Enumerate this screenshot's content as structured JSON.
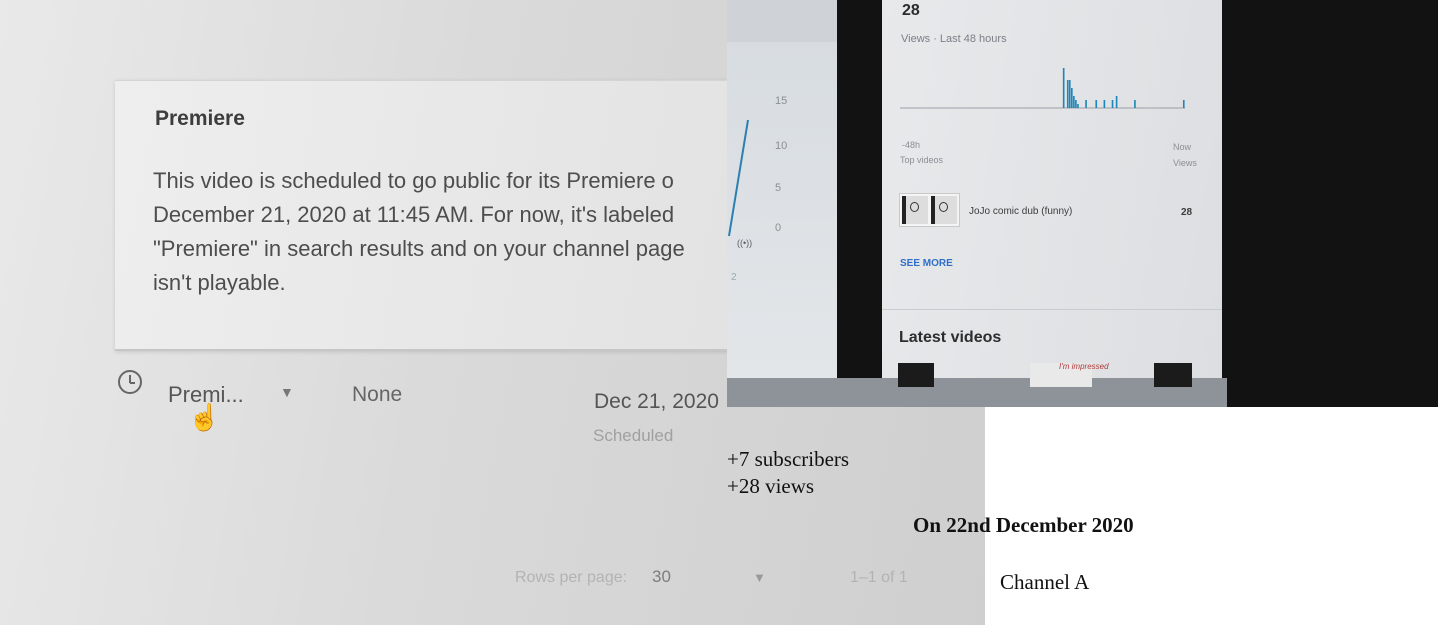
{
  "left_photo": {
    "card": {
      "title": "Premiere",
      "description_lines": [
        "This video is scheduled to go public for its Premiere o",
        "December 21, 2020 at 11:45 AM. For now, it's labeled",
        "\"Premiere\" in search results and on your channel page",
        "isn't playable."
      ]
    },
    "video_row": {
      "visibility": "Premi...",
      "restrictions": "None",
      "date": "Dec 21, 2020",
      "status": "Scheduled"
    },
    "pagination": {
      "rows_per_page_label": "Rows per page:",
      "rows_per_page_value": "30",
      "range": "1–1 of 1"
    }
  },
  "right_photo": {
    "chart_axis": {
      "y_ticks": [
        "15",
        "10",
        "5",
        "0"
      ],
      "x_tick": "2"
    },
    "views_card": {
      "count": "28",
      "caption": "Views · Last 48 hours",
      "axis_start": "-48h",
      "axis_end": "Now",
      "top_videos_label": "Top videos",
      "top_videos_metric": "Views",
      "top_video_title": "JoJo comic dub (funny)",
      "top_video_views": "28",
      "see_more": "SEE MORE"
    },
    "latest_videos_title": "Latest videos",
    "latest_scribble": "I'm impressed"
  },
  "captions": {
    "subscribers": "+7 subscribers",
    "views": "+28 views",
    "date": "On 22nd December 2020",
    "channel": "Channel A"
  },
  "chart_data": {
    "type": "bar",
    "title": "Views · Last 48 hours",
    "xlabel": "",
    "ylabel": "",
    "x_range": [
      "-48h",
      "Now"
    ],
    "values": [
      0,
      0,
      0,
      0,
      0,
      0,
      0,
      0,
      0,
      0,
      0,
      0,
      0,
      0,
      0,
      0,
      0,
      0,
      0,
      0,
      0,
      0,
      0,
      0,
      0,
      0,
      0,
      0,
      0,
      0,
      0,
      0,
      0,
      0,
      0,
      0,
      0,
      0,
      0,
      0,
      0,
      0,
      0,
      0,
      0,
      0,
      0,
      0,
      0,
      0,
      0,
      0,
      0,
      0,
      0,
      0,
      0,
      0,
      0,
      0,
      0,
      0,
      0,
      0,
      0,
      0,
      0,
      0,
      0,
      0,
      0,
      0,
      0,
      0,
      0,
      0,
      0,
      0,
      0,
      0,
      10,
      0,
      7,
      7,
      5,
      3,
      2,
      1,
      0,
      0,
      0,
      2,
      0,
      0,
      0,
      0,
      2,
      0,
      0,
      0,
      2,
      0,
      0,
      0,
      2,
      0,
      3,
      0,
      0,
      0,
      0,
      0,
      0,
      0,
      0,
      2,
      0,
      0,
      0,
      0,
      0,
      0,
      0,
      0,
      0,
      0,
      0,
      0,
      0,
      0,
      0,
      0,
      0,
      0,
      0,
      0,
      0,
      0,
      0,
      2
    ],
    "colors": {
      "bar": "#1e86b8"
    }
  }
}
